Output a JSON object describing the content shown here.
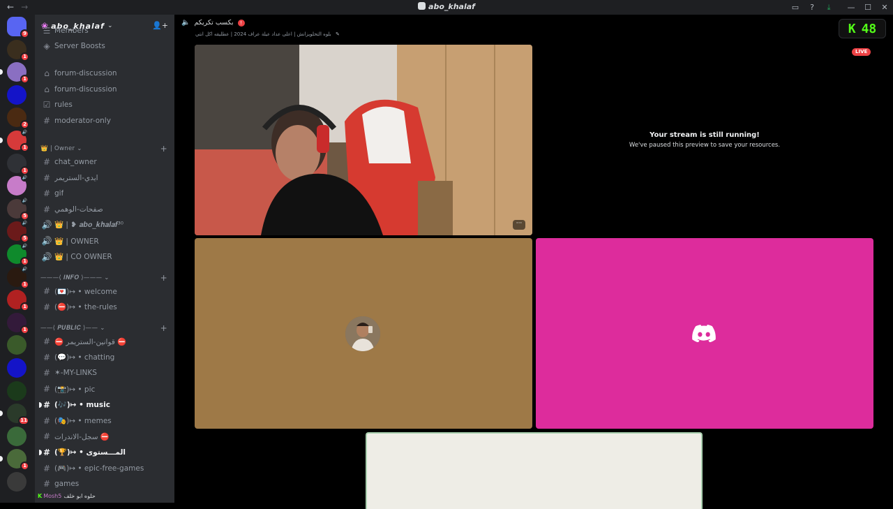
{
  "titlebar": {
    "back": "←",
    "forward": "→",
    "title": "abo_khalaf",
    "icons": [
      "inbox-icon",
      "help-icon",
      "download-icon",
      "minimize-icon",
      "maximize-icon",
      "close-icon"
    ],
    "icon_glyphs": [
      "▭",
      "?",
      "⤓",
      "—",
      "☐",
      "✕"
    ]
  },
  "guilds": {
    "items": [
      {
        "name": "discord-home",
        "badge": "9",
        "color": "#5865f2"
      },
      {
        "name": "server-1",
        "badge": "1",
        "color": "#3a2e1e"
      },
      {
        "name": "server-2",
        "badge": "1",
        "color": "#8a6fc2"
      },
      {
        "name": "server-3",
        "badge": "",
        "color": "#1414c8"
      },
      {
        "name": "server-4",
        "badge": "2",
        "color": "#4a2a12"
      },
      {
        "name": "server-5",
        "badge": "1",
        "color": "#d63a3a"
      },
      {
        "name": "server-6",
        "badge": "1",
        "color": "#2f3136"
      },
      {
        "name": "server-7",
        "badge": "",
        "color": "#c77cc9"
      },
      {
        "name": "server-8",
        "badge": "5",
        "color": "#4b3a3a"
      },
      {
        "name": "server-9",
        "badge": "5",
        "color": "#6b1a1a"
      },
      {
        "name": "server-10",
        "badge": "1",
        "color": "#0f8a2c"
      },
      {
        "name": "server-11",
        "badge": "1",
        "color": "#2a1a10"
      },
      {
        "name": "server-12",
        "badge": "1",
        "color": "#b02121"
      },
      {
        "name": "server-13",
        "badge": "1",
        "color": "#331a3a"
      },
      {
        "name": "server-14",
        "badge": "",
        "color": "#3a5a2a"
      },
      {
        "name": "server-15",
        "badge": "",
        "color": "#1414c8"
      },
      {
        "name": "server-16",
        "badge": "",
        "color": "#1b3a1b"
      },
      {
        "name": "server-17",
        "badge": "11",
        "color": "#2a3a2a"
      },
      {
        "name": "server-18",
        "badge": "",
        "color": "#3a6a3a"
      },
      {
        "name": "server-19",
        "badge": "1",
        "color": "#4a6a3a"
      },
      {
        "name": "server-20",
        "badge": "",
        "color": "#3a3a3a"
      }
    ]
  },
  "sidebar": {
    "server_name": "abo_khalaf",
    "channels_top": [
      {
        "icon": "☰",
        "label": "Members",
        "cls": ""
      },
      {
        "icon": "◈",
        "label": "Server Boosts",
        "cls": ""
      },
      {
        "icon": "⌂",
        "label": "forum-discussion",
        "cls": ""
      },
      {
        "icon": "⌂",
        "label": "forum-discussion",
        "cls": ""
      },
      {
        "icon": "☑",
        "label": "rules",
        "cls": ""
      },
      {
        "icon": "#",
        "label": "moderator-only",
        "cls": ""
      }
    ],
    "cat_owner": "👑 | Owner ⌄",
    "owner_channels": [
      {
        "icon": "#",
        "label": "chat_owner"
      },
      {
        "icon": "#",
        "label": "ايدي-الستريمر"
      },
      {
        "icon": "#",
        "label": "gif"
      },
      {
        "icon": "#",
        "label": "صفحات-الوهمي"
      },
      {
        "icon": "🔊",
        "label": "👑 | ❥ 𝒂𝒃𝒐_𝒌𝒉𝒂𝒍𝒂𝒇³⁰"
      },
      {
        "icon": "🔊",
        "label": "👑 | OWNER"
      },
      {
        "icon": "🔊",
        "label": "👑 | CO OWNER"
      }
    ],
    "cat_info": "———⟨ 𝑰𝑵𝑭𝑶 ⟩——— ⌄",
    "info_channels": [
      {
        "icon": "#",
        "label": "(💌)↦ • welcome"
      },
      {
        "icon": "#",
        "label": "(⛔)↦ • the-rules"
      }
    ],
    "cat_public": "——⟨ 𝑷𝑼𝑩𝑳𝑰𝑪 ⟩—— ⌄",
    "public_channels": [
      {
        "icon": "#",
        "label": "⛔ قوانين-الستريمر ⛔",
        "bright": false
      },
      {
        "icon": "#",
        "label": "(💬)↦ • chatting",
        "bright": false
      },
      {
        "icon": "#",
        "label": "✶-MY-LINKS",
        "bright": false
      },
      {
        "icon": "#",
        "label": "(📸)↦ • pic",
        "bright": false
      },
      {
        "icon": "#",
        "label": "(🎶)↦ • music",
        "bright": true
      },
      {
        "icon": "#",
        "label": "(🎭)↦ • memes",
        "bright": false
      },
      {
        "icon": "#",
        "label": "سجل-الاندرات ⛔",
        "bright": false
      },
      {
        "icon": "#",
        "label": "(🏆)↦ • المـــستوى",
        "bright": true
      },
      {
        "icon": "#",
        "label": "(🎮)↦ • epic-free-games",
        "bright": false
      },
      {
        "icon": "#",
        "label": "games",
        "bright": false
      }
    ],
    "userbar_name": "Mosh5",
    "userbar_tag": "حلوه ابو خلف"
  },
  "stage": {
    "channel_title": "بكسب تكريكم",
    "channel_status": "بلوه التحلويزانش | اعلى عداد عيلة عراف 2024 | عطليقه اكل انتي",
    "kick_count": "48",
    "kick_letter": "K",
    "live_label": "LIVE",
    "paused_title": "Your stream is still running!",
    "paused_sub": "We've paused this preview to save your resources.",
    "more_label": "···"
  },
  "colors": {
    "accent_pink": "#dd2c9c",
    "accent_brown": "#9e7947",
    "kick_green": "#53fc18",
    "live_red": "#ed4245"
  }
}
